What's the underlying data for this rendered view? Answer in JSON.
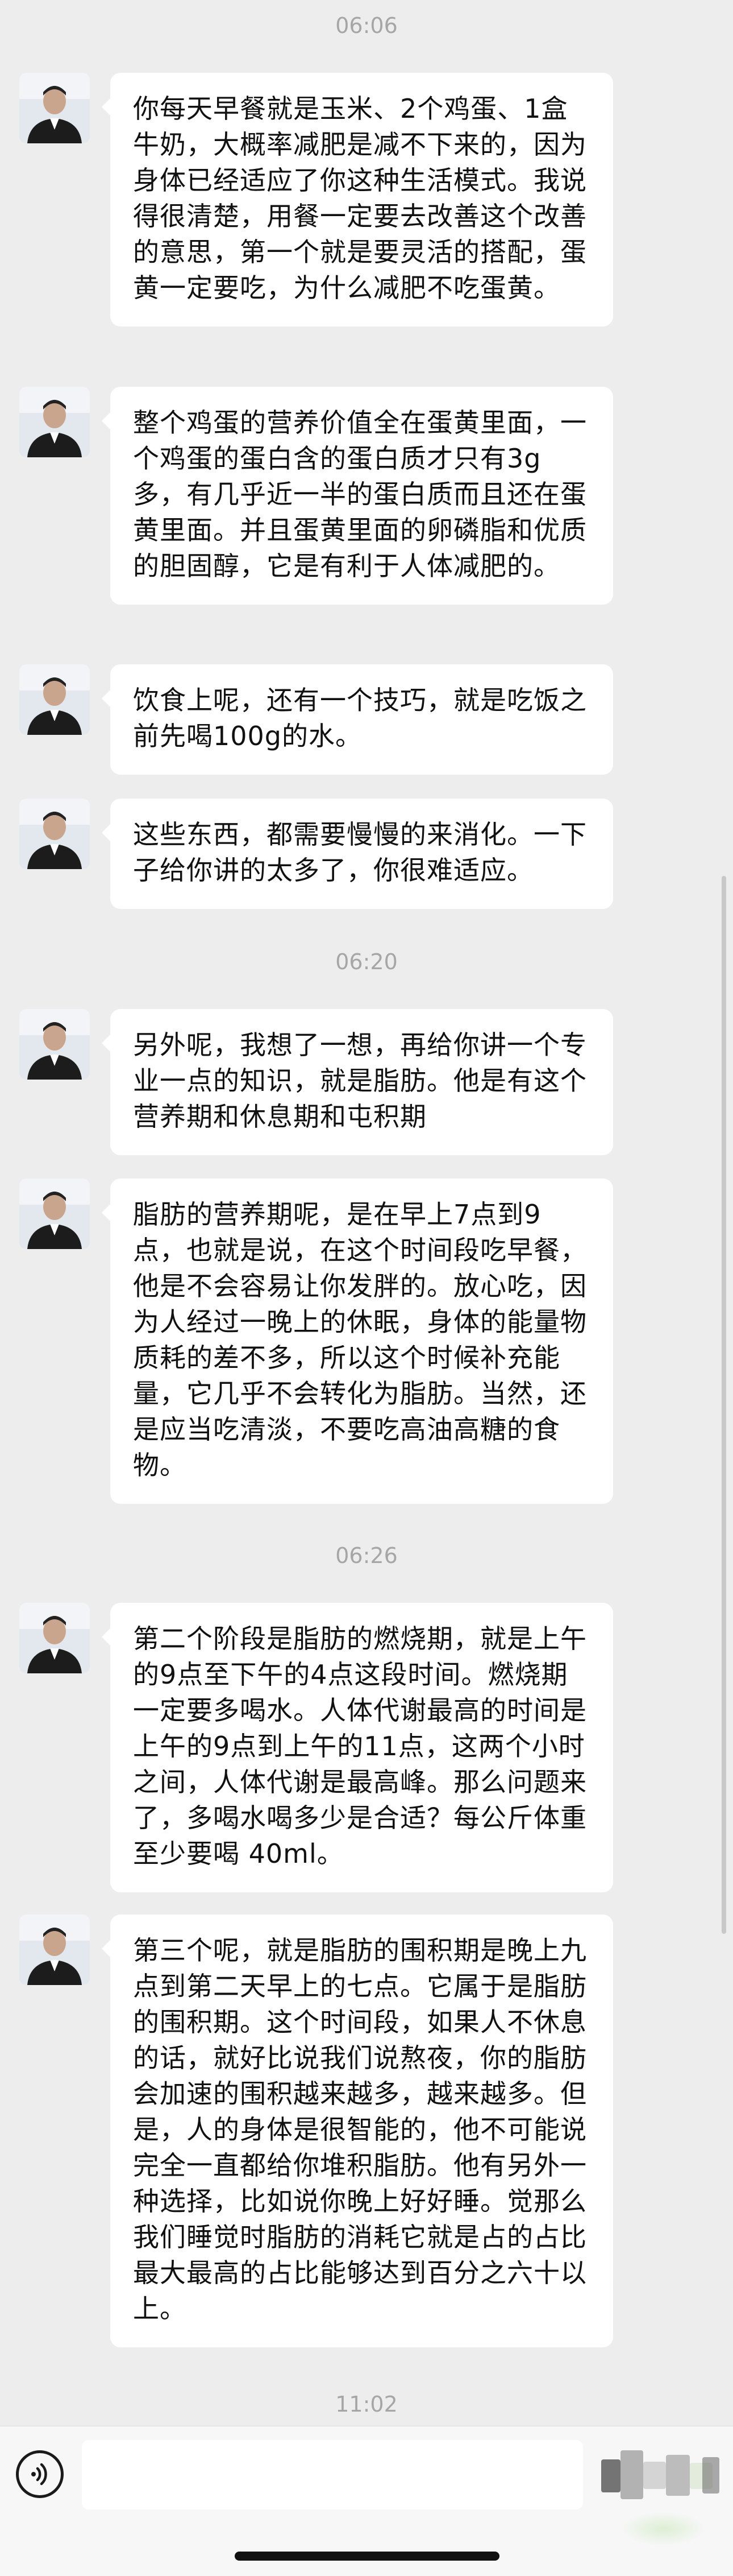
{
  "messages": [
    {
      "kind": "time",
      "text": "06:06"
    },
    {
      "kind": "msg",
      "text": "你每天早餐就是玉米、2个鸡蛋、1盒牛奶，大概率减肥是减不下来的，因为身体已经适应了你这种生活模式。我说得很清楚，用餐一定要去改善这个改善的意思，第一个就是要灵活的搭配，蛋黄一定要吃，为什么减肥不吃蛋黄。"
    },
    {
      "kind": "msg",
      "text": "整个鸡蛋的营养价值全在蛋黄里面，一个鸡蛋的蛋白含的蛋白质才只有3g多，有几乎近一半的蛋白质而且还在蛋黄里面。并且蛋黄里面的卵磷脂和优质的胆固醇，它是有利于人体减肥的。"
    },
    {
      "kind": "msg",
      "text": "饮食上呢，还有一个技巧，就是吃饭之前先喝100g的水。"
    },
    {
      "kind": "msg",
      "text": "这些东西，都需要慢慢的来消化。一下子给你讲的太多了，你很难适应。"
    },
    {
      "kind": "time",
      "text": "06:20"
    },
    {
      "kind": "msg",
      "text": "另外呢，我想了一想，再给你讲一个专业一点的知识，就是脂肪。他是有这个营养期和休息期和屯积期"
    },
    {
      "kind": "msg",
      "text": "脂肪的营养期呢，是在早上7点到9点，也就是说，在这个时间段吃早餐，他是不会容易让你发胖的。放心吃，因为人经过一晚上的休眠，身体的能量物质耗的差不多，所以这个时候补充能量，它几乎不会转化为脂肪。当然，还是应当吃清淡，不要吃高油高糖的食物。"
    },
    {
      "kind": "time",
      "text": "06:26"
    },
    {
      "kind": "msg",
      "text": "第二个阶段是脂肪的燃烧期，就是上午的9点至下午的4点这段时间。燃烧期一定要多喝水。人体代谢最高的时间是上午的9点到上午的11点，这两个小时之间，人体代谢是最高峰。那么问题来了，多喝水喝多少是合适？每公斤体重至少要喝 40ml。"
    },
    {
      "kind": "msg",
      "text": "第三个呢，就是脂肪的围积期是晚上九点到第二天早上的七点。它属于是脂肪的围积期。这个时间段，如果人不休息的话，就好比说我们说熬夜，你的脂肪会加速的围积越来越多，越来越多。但是，人的身体是很智能的，他不可能说完全一直都给你堆积脂肪。他有另外一种选择，比如说你晚上好好睡。觉那么我们睡觉时脂肪的消耗它就是占的占比最大最高的占比能够达到百分之六十以上。"
    },
    {
      "kind": "time",
      "text": "11:02"
    }
  ],
  "input": {
    "placeholder": "",
    "value": ""
  },
  "icons": {
    "voice": "voice-icon",
    "avatar": "contact-avatar"
  },
  "colors": {
    "background": "#ededed",
    "bubble": "#ffffff",
    "timestamp": "#a6a6a6",
    "text": "#111111"
  }
}
